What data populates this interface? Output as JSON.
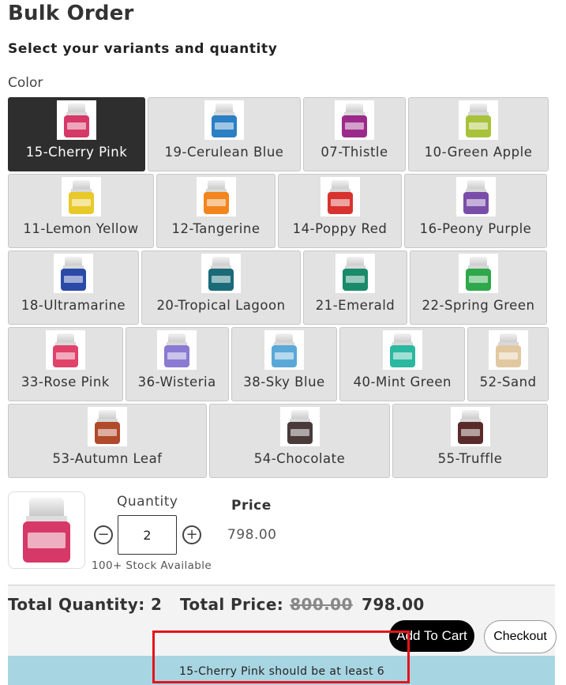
{
  "page": {
    "title": "Bulk Order",
    "subtitle": "Select your variants and quantity",
    "color_label": "Color"
  },
  "variants": [
    {
      "label": "15-Cherry Pink",
      "color": "#d63868",
      "selected": true
    },
    {
      "label": "19-Cerulean Blue",
      "color": "#2b7fc4"
    },
    {
      "label": "07-Thistle",
      "color": "#9c2a8a"
    },
    {
      "label": "10-Green Apple",
      "color": "#a8c23a"
    },
    {
      "label": "11-Lemon Yellow",
      "color": "#e8c92a"
    },
    {
      "label": "12-Tangerine",
      "color": "#f2851e"
    },
    {
      "label": "14-Poppy Red",
      "color": "#d8332e"
    },
    {
      "label": "16-Peony Purple",
      "color": "#7a4ea8"
    },
    {
      "label": "18-Ultramarine",
      "color": "#2a4aa8"
    },
    {
      "label": "20-Tropical Lagoon",
      "color": "#1a6a78"
    },
    {
      "label": "21-Emerald",
      "color": "#1a8a6a"
    },
    {
      "label": "22-Spring Green",
      "color": "#2ea84a"
    },
    {
      "label": "33-Rose Pink",
      "color": "#e0426a"
    },
    {
      "label": "36-Wisteria",
      "color": "#8a7ad2"
    },
    {
      "label": "38-Sky Blue",
      "color": "#5aa8d8"
    },
    {
      "label": "40-Mint Green",
      "color": "#2ab8a0"
    },
    {
      "label": "52-Sand",
      "color": "#e2c8a0"
    },
    {
      "label": "53-Autumn Leaf",
      "color": "#b04a2a"
    },
    {
      "label": "54-Chocolate",
      "color": "#4a3a3a"
    },
    {
      "label": "55-Truffle",
      "color": "#5a2a2a"
    }
  ],
  "selected_product": {
    "image_icon": "cherry-pink-bottle-image",
    "color": "#d63868",
    "quantity_label": "Quantity",
    "quantity_value": "2",
    "minus_symbol": "−",
    "plus_symbol": "+",
    "stock_text": "100+ Stock Available",
    "price_label": "Price",
    "price_value": "798.00"
  },
  "summary": {
    "total_quantity_text": "Total Quantity: 2",
    "total_price_label": "Total Price:",
    "old_price": "800.00",
    "new_price": "798.00",
    "add_to_cart_label": "Add To Cart",
    "checkout_label": "Checkout",
    "error_message": "15-Cherry Pink should be at least 6",
    "error_highlight_color": "#e8121a",
    "error_bar_color": "#a8d5e2"
  }
}
